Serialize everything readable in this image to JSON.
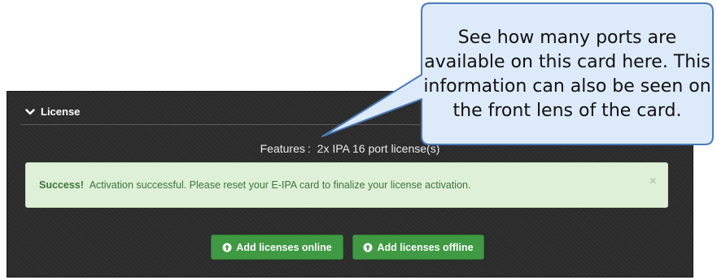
{
  "license_panel": {
    "header_label": "License",
    "features_label": "Features",
    "features_separator": ":",
    "features_value": "2x IPA 16 port license(s)"
  },
  "alert": {
    "strong_text": "Success!",
    "message": "Activation successful. Please reset your E-IPA card to finalize your license activation.",
    "close_symbol": "×"
  },
  "buttons": {
    "add_online_label": "Add licenses online",
    "add_offline_label": "Add licenses offline"
  },
  "callout": {
    "text": "See how many ports are available on this card here. This information can also be seen on the front lens of the card."
  },
  "colors": {
    "panel_bg": "#2b2b2b",
    "alert_bg": "#dff0d8",
    "alert_text": "#3c763d",
    "button_green": "#3f9a43",
    "callout_fill": "#ddeafa",
    "callout_border": "#4a7ab8"
  },
  "icons": {
    "header_icon": "chevron-down-icon",
    "button_icon": "circle-arrow-up-icon",
    "close_icon": "close-icon"
  }
}
